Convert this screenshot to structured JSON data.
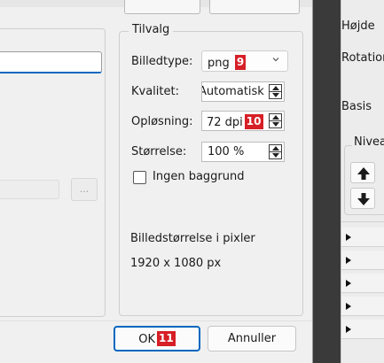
{
  "options": {
    "group_title": "Tilvalg",
    "image_type": {
      "label": "Billedtype:",
      "value": "png",
      "badge": "9"
    },
    "quality": {
      "label": "Kvalitet:",
      "value": "Automatisk"
    },
    "resolution": {
      "label": "Opløsning:",
      "value": "72 dpi",
      "badge": "10"
    },
    "size": {
      "label": "Størrelse:",
      "value": "100 %"
    },
    "no_background": {
      "label": "Ingen baggrund",
      "checked": false
    },
    "pixel_size_label": "Billedstørrelse i pixler",
    "pixel_size_value": "1920 x 1080 px"
  },
  "left": {
    "browse_label": "..."
  },
  "footer": {
    "ok_label": "OK",
    "ok_badge": "11",
    "cancel_label": "Annuller"
  },
  "right_panel": {
    "label_height": "Højde",
    "label_rotation": "Rotation",
    "label_base": "Basis",
    "group_title": "Niveau",
    "rows": [
      "",
      "",
      "",
      "",
      ""
    ]
  }
}
